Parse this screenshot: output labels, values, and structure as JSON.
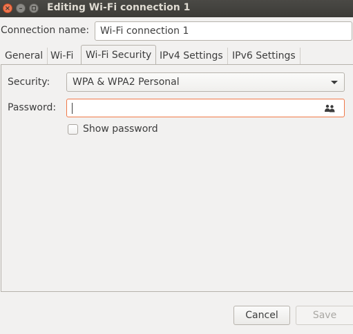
{
  "window": {
    "title": "Editing Wi-Fi connection 1",
    "close_glyph": "×",
    "min_glyph": "–"
  },
  "connection": {
    "label": "Connection name:",
    "value": "Wi-Fi connection 1"
  },
  "tabs": [
    {
      "label": "General"
    },
    {
      "label": "Wi-Fi"
    },
    {
      "label": "Wi-Fi Security"
    },
    {
      "label": "IPv4 Settings"
    },
    {
      "label": "IPv6 Settings"
    }
  ],
  "security": {
    "label": "Security:",
    "selected": "WPA & WPA2 Personal"
  },
  "password": {
    "label": "Password:",
    "value": "",
    "icon": "people-icon"
  },
  "show_password": {
    "label": "Show password",
    "checked": false
  },
  "buttons": {
    "cancel": "Cancel",
    "save": "Save"
  },
  "colors": {
    "focus_border": "#f07746",
    "titlebar": "#3c3b37"
  }
}
